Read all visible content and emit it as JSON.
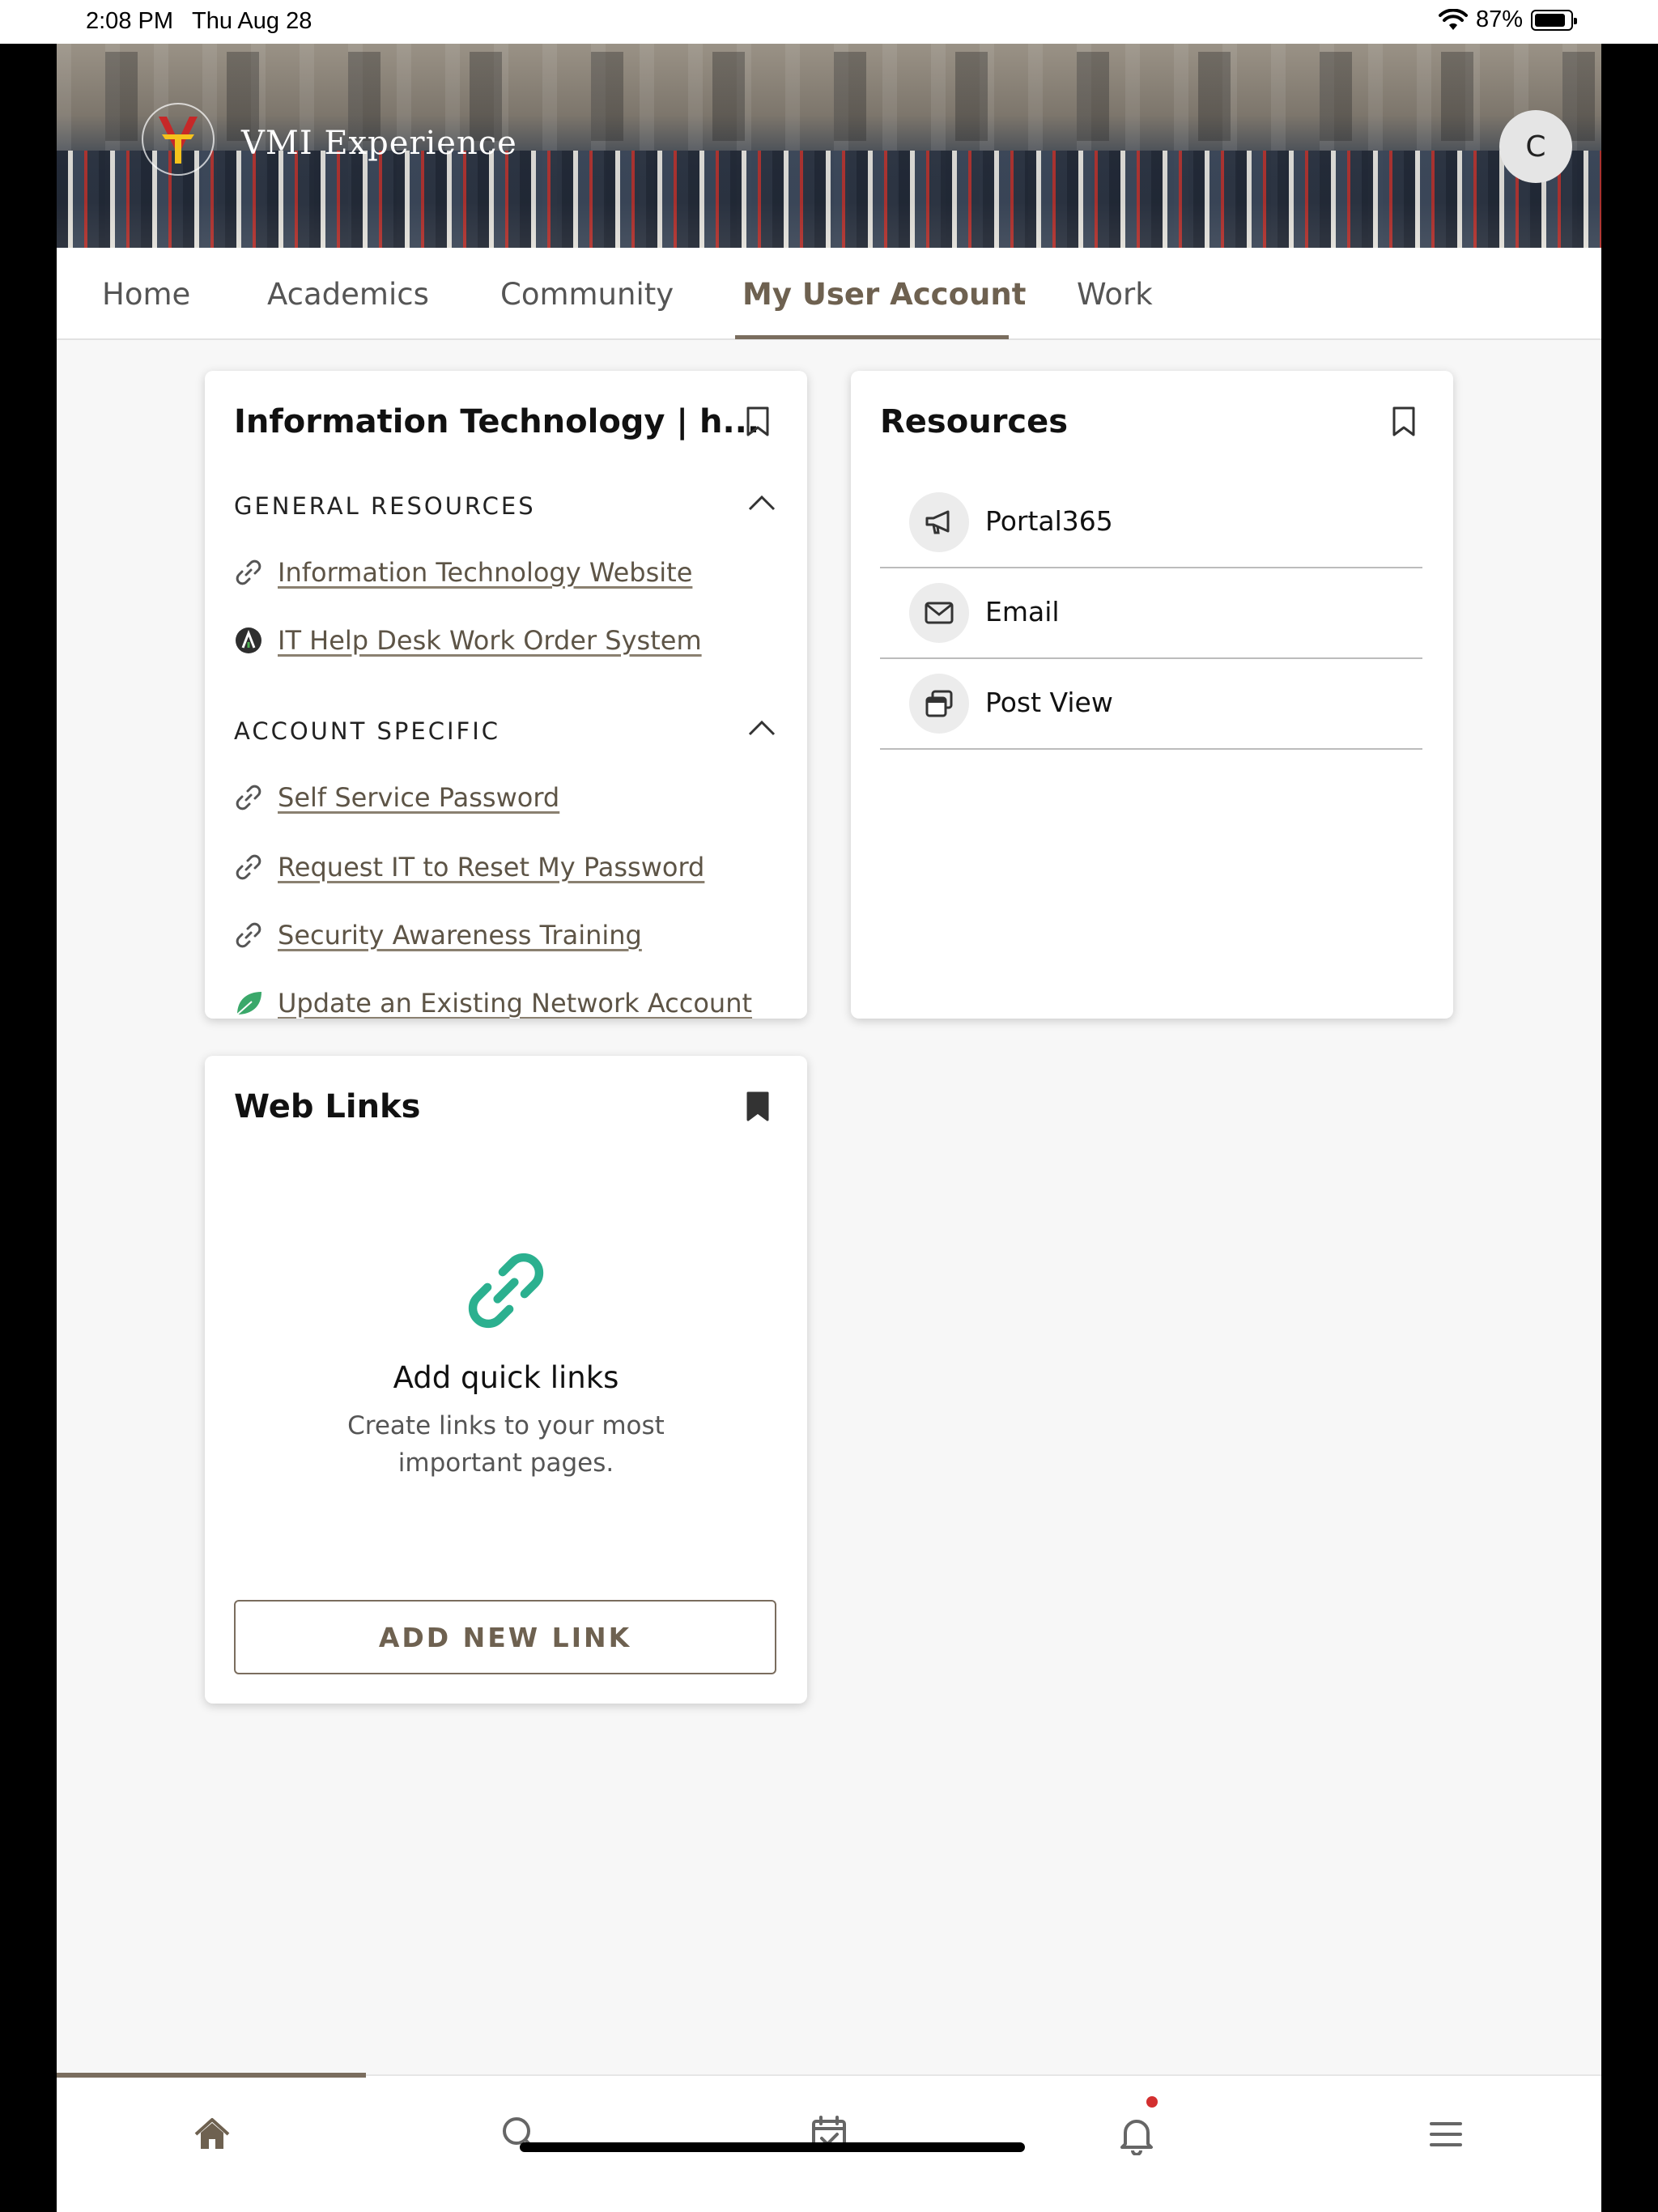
{
  "status_bar": {
    "time": "2:08 PM",
    "date": "Thu Aug 28",
    "battery": "87%"
  },
  "header": {
    "app_title": "VMI Experience",
    "avatar_initial": "C"
  },
  "tabs": [
    {
      "label": "Home"
    },
    {
      "label": "Academics"
    },
    {
      "label": "Community"
    },
    {
      "label": "My User Account",
      "active": true
    },
    {
      "label": "Work"
    }
  ],
  "it_card": {
    "title": "Information Technology | h...",
    "sections": [
      {
        "heading": "GENERAL RESOURCES",
        "links": [
          "Information Technology Website",
          "IT Help Desk Work Order System"
        ]
      },
      {
        "heading": "ACCOUNT SPECIFIC",
        "links": [
          "Self Service Password",
          "Request IT to Reset My Password",
          "Security Awareness Training",
          "Update an Existing Network Account"
        ]
      }
    ]
  },
  "resources_card": {
    "title": "Resources",
    "items": [
      {
        "label": "Portal365",
        "icon": "megaphone-icon"
      },
      {
        "label": "Email",
        "icon": "envelope-icon"
      },
      {
        "label": "Post View",
        "icon": "windows-stack-icon"
      }
    ]
  },
  "weblinks_card": {
    "title": "Web Links",
    "empty_title": "Add quick links",
    "empty_description": "Create links to your most important pages.",
    "button_label": "ADD NEW LINK"
  },
  "bottom_nav": [
    "home-icon",
    "search-icon",
    "calendar-check-icon",
    "bell-icon",
    "menu-icon"
  ],
  "colors": {
    "accent": "#7a6d5e",
    "link_teal": "#2bb08f",
    "notification": "#d32f2f"
  }
}
